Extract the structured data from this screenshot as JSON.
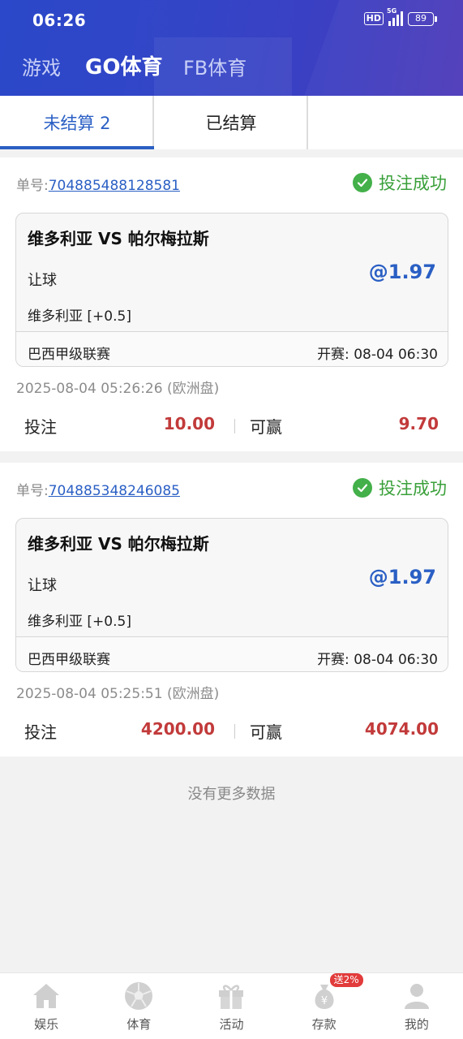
{
  "status_bar": {
    "time": "06:26",
    "hd": "HD",
    "network": "5G",
    "battery": "89"
  },
  "top_tabs": [
    {
      "label": "游戏",
      "active": false
    },
    {
      "label": "GO体育",
      "active": true
    },
    {
      "label": "FB体育",
      "active": false
    }
  ],
  "sub_tabs": [
    {
      "label": "未结算 2",
      "active": true
    },
    {
      "label": "已结算",
      "active": false
    },
    {
      "label": "",
      "active": false
    }
  ],
  "bets": [
    {
      "order_label": "单号:",
      "order_no": "704885488128581",
      "status": "投注成功",
      "match": "维多利亚 VS 帕尔梅拉斯",
      "bet_type": "让球",
      "odds": "@1.97",
      "selection": "维多利亚 [+0.5]",
      "league": "巴西甲级联赛",
      "start_time": "开赛: 08-04 06:30",
      "placed_at": "2025-08-04 05:26:26 (欧洲盘)",
      "stake_label": "投注",
      "stake": "10.00",
      "win_label": "可赢",
      "win": "9.70"
    },
    {
      "order_label": "单号:",
      "order_no": "704885348246085",
      "status": "投注成功",
      "match": "维多利亚 VS 帕尔梅拉斯",
      "bet_type": "让球",
      "odds": "@1.97",
      "selection": "维多利亚 [+0.5]",
      "league": "巴西甲级联赛",
      "start_time": "开赛: 08-04 06:30",
      "placed_at": "2025-08-04 05:25:51 (欧洲盘)",
      "stake_label": "投注",
      "stake": "4200.00",
      "win_label": "可赢",
      "win": "4074.00"
    }
  ],
  "no_more": "没有更多数据",
  "bottom_nav": [
    {
      "label": "娱乐",
      "icon": "home-icon"
    },
    {
      "label": "体育",
      "icon": "soccer-ball-icon"
    },
    {
      "label": "活动",
      "icon": "gift-icon"
    },
    {
      "label": "存款",
      "icon": "money-bag-icon",
      "badge": "送2%"
    },
    {
      "label": "我的",
      "icon": "user-icon"
    }
  ],
  "colors": {
    "accent": "#2a5fc4",
    "success": "#43b049",
    "money": "#c23a3a",
    "header": "#3345c7"
  }
}
